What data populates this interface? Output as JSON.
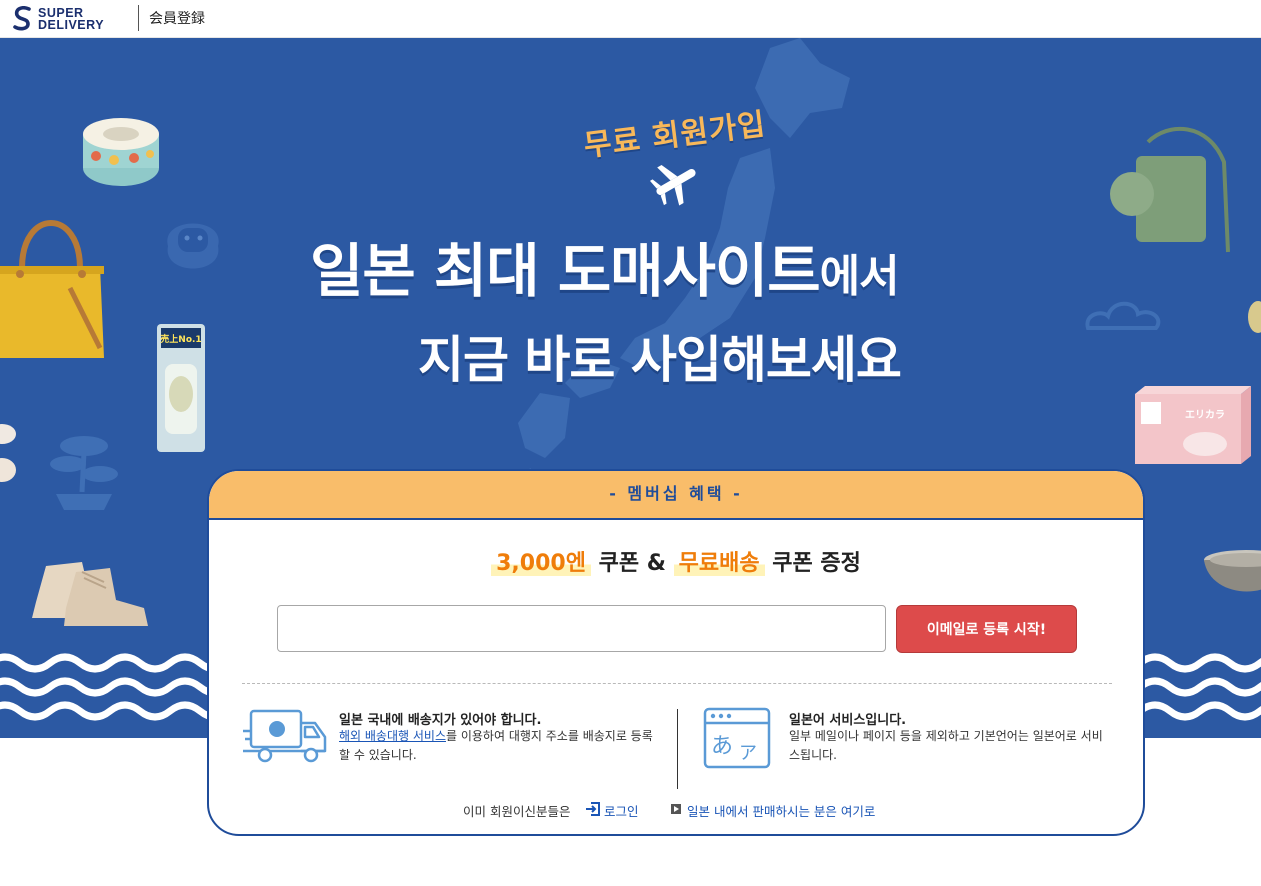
{
  "header": {
    "logo_line1": "SUPER",
    "logo_line2": "DELIVERY",
    "title": "会員登録"
  },
  "hero": {
    "subtitle": "무료 회원가입",
    "headline_main": "일본 최대 도매사이트",
    "headline_suffix": "에서",
    "headline_line2": "지금 바로 사입해보세요",
    "deco_texts": {
      "deodorant_badge": "売上No.1",
      "mask_box_label": "エリカラ"
    }
  },
  "card": {
    "header_label": "- 멤버십 혜택 -",
    "coupon_amount": "3,000엔",
    "coupon_text1": "쿠폰 &",
    "free_shipping": "무료배송",
    "coupon_text2": "쿠폰 증정",
    "email_input_value": "",
    "email_input_placeholder": "",
    "start_button": "이메일로 등록 시작!",
    "info_shipping": {
      "title": "일본 국내에 배송지가 있어야 합니다.",
      "link_text": "해외 배송대행 서비스",
      "body_text": "를 이용하여 대행지 주소를 배송지로 등록할 수 있습니다."
    },
    "info_language": {
      "title": "일본어 서비스입니다.",
      "body_text": "일부 메일이나 페이지 등을 제외하고 기본언어는 일본어로 서비스됩니다."
    },
    "bottom": {
      "member_text": "이미 회원이신분들은",
      "login_link": "로그인",
      "seller_link": "일본 내에서 판매하시는 분은 여기로"
    }
  },
  "colors": {
    "hero_blue": "#2c59a3",
    "card_header_orange": "#f9bd6a",
    "accent_orange": "#ef7d0a",
    "button_red": "#dd4b4b",
    "link_blue": "#1a55b6",
    "headline_gold": "#f8b85a"
  },
  "icons": [
    "super-delivery-logo-icon",
    "airplane-icon",
    "delivery-truck-icon",
    "language-browser-icon",
    "login-icon",
    "arrow-right-icon"
  ]
}
